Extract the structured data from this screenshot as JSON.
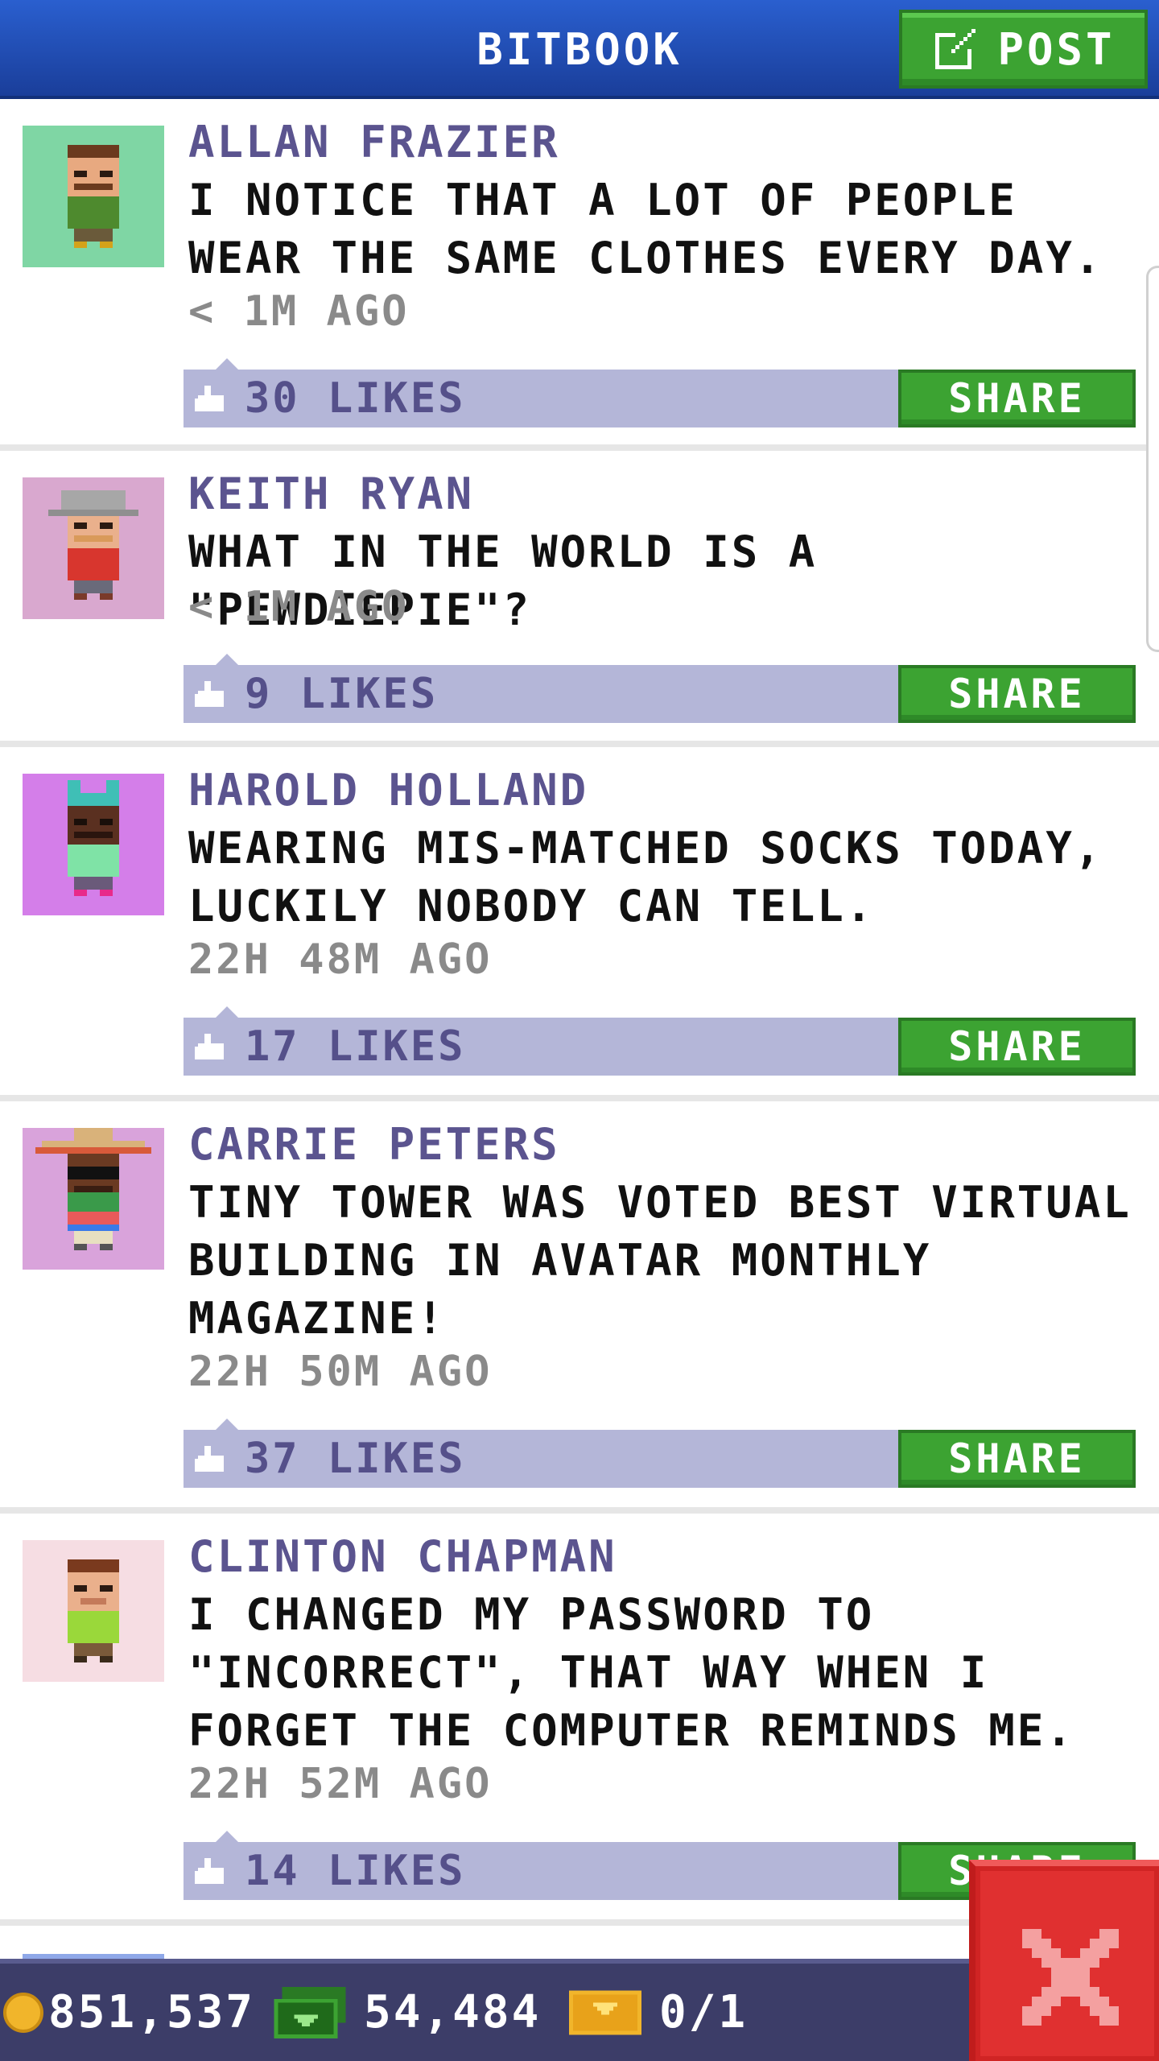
{
  "header": {
    "title": "BITBOOK",
    "post_label": "POST"
  },
  "posts": [
    {
      "author": "ALLAN FRAZIER",
      "message": "I NOTICE THAT A LOT OF PEOPLE WEAR THE SAME CLOTHES EVERY DAY.",
      "time": "< 1M AGO",
      "likes": "30 LIKES",
      "share": "SHARE",
      "avatar_bg": "#7fd6a4"
    },
    {
      "author": "KEITH RYAN",
      "message": "WHAT IN THE WORLD IS A \"PEWDIEPIE\"?",
      "time": "< 1M AGO",
      "likes": "9 LIKES",
      "share": "SHARE",
      "avatar_bg": "#d9a8cf"
    },
    {
      "author": "HAROLD HOLLAND",
      "message": "WEARING MIS-MATCHED SOCKS TODAY, LUCKILY NOBODY CAN TELL.",
      "time": "22H 48M AGO",
      "likes": "17 LIKES",
      "share": "SHARE",
      "avatar_bg": "#d47ee9"
    },
    {
      "author": "CARRIE PETERS",
      "message": "TINY TOWER WAS VOTED BEST VIRTUAL BUILDING IN AVATAR MONTHLY MAGAZINE!",
      "time": "22H 50M AGO",
      "likes": "37 LIKES",
      "share": "SHARE",
      "avatar_bg": "#d9a3db"
    },
    {
      "author": "CLINTON CHAPMAN",
      "message": "I CHANGED MY PASSWORD TO \"INCORRECT\", THAT WAY WHEN I FORGET THE COMPUTER REMINDS ME.",
      "time": "22H 52M AGO",
      "likes": "14 LIKES",
      "share": "SHARE",
      "avatar_bg": "#f6dde3"
    }
  ],
  "bottom_bar": {
    "coins": "851,537",
    "bux": "54,484",
    "tickets": "0/1"
  },
  "colors": {
    "accent_green": "#3ca332",
    "header_blue": "#1f4fb8",
    "like_bar": "#b4b6d8",
    "close_red": "#e03030"
  }
}
